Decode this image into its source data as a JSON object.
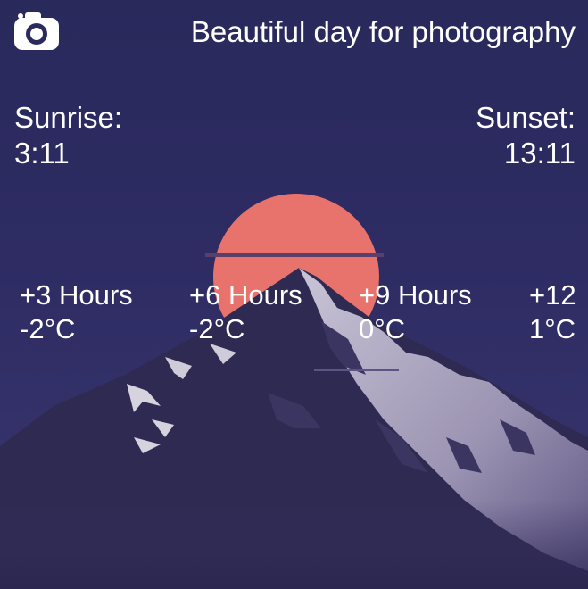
{
  "header": {
    "camera_icon": "camera-icon",
    "headline": "Beautiful day for photography"
  },
  "sun": {
    "sunrise_label": "Sunrise:",
    "sunrise_time": "3:11",
    "sunset_label": "Sunset:",
    "sunset_time": "13:11"
  },
  "forecast": [
    {
      "label": "+3 Hours",
      "temp": "-2°C"
    },
    {
      "label": "+6 Hours",
      "temp": "-2°C"
    },
    {
      "label": "+9 Hours",
      "temp": "0°C"
    },
    {
      "label": "+12",
      "temp": "1°C"
    }
  ],
  "colors": {
    "sky_top": "#29295c",
    "sun": "#e8736c",
    "mountain_shadow": "#2f2a52",
    "mountain_highlight": "#cfcbd8"
  }
}
